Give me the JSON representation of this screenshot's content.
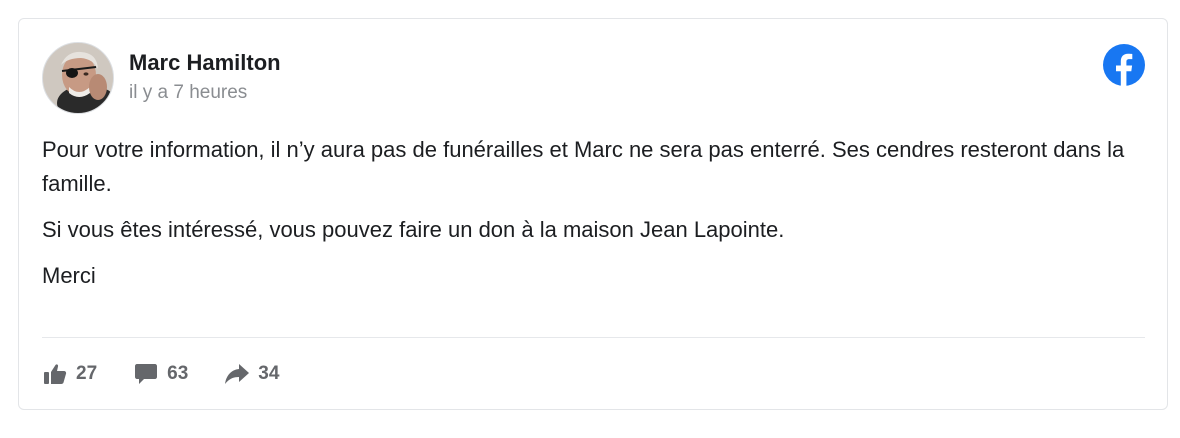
{
  "post": {
    "author": "Marc Hamilton",
    "timestamp": "il y a 7 heures",
    "paragraphs": [
      "Pour votre information, il n’y aura pas de funérailles et Marc ne sera pas enterré. Ses cendres resteront dans la famille.",
      "Si vous êtes intéressé, vous pouvez faire un don à la maison Jean Lapointe.",
      "Merci"
    ]
  },
  "stats": {
    "likes": "27",
    "comments": "63",
    "shares": "34"
  },
  "icons": {
    "brand": "facebook-logo-icon",
    "like": "thumbs-up-icon",
    "comment": "comment-bubble-icon",
    "share": "share-arrow-icon"
  },
  "colors": {
    "brand": "#1877f2",
    "icon_gray": "#65676b",
    "muted_text": "#8a8d91"
  }
}
